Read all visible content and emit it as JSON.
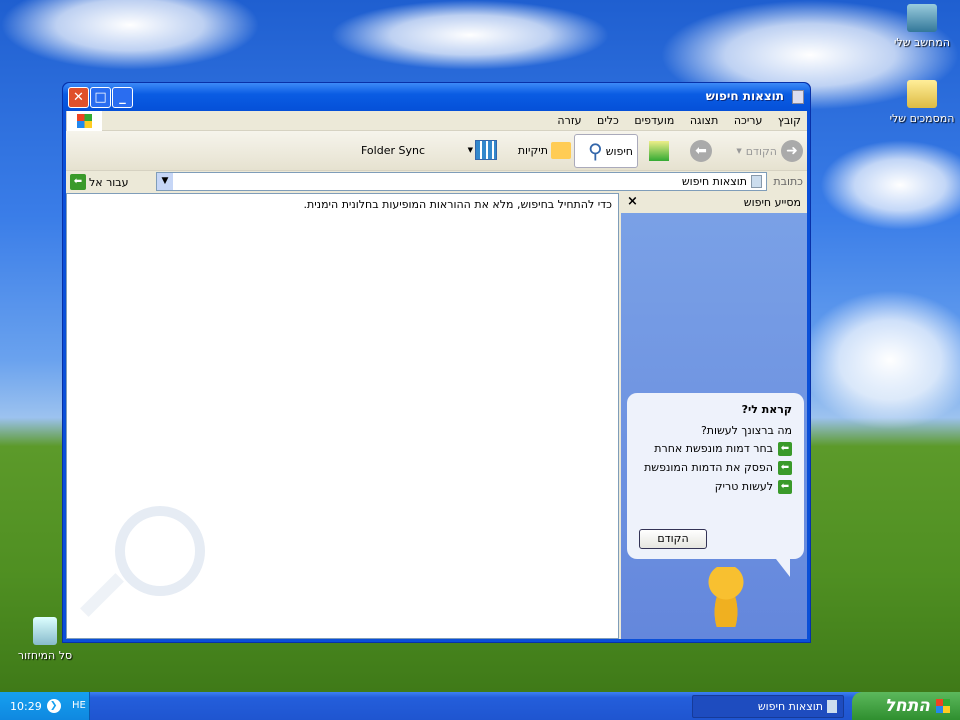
{
  "desktop": {
    "icons": [
      {
        "label": "המחשב שלי"
      },
      {
        "label": "המסמכים שלי"
      },
      {
        "label": "סל המיחזור"
      }
    ]
  },
  "window": {
    "title": "תוצאות חיפוש",
    "menu": [
      "קובץ",
      "עריכה",
      "תצוגה",
      "מועדפים",
      "כלים",
      "עזרה"
    ],
    "toolbar": {
      "back": "הקודם",
      "search": "חיפוש",
      "folders": "תיקיות",
      "folder_sync": "Folder Sync"
    },
    "address": {
      "label": "כתובת",
      "value": "תוצאות חיפוש",
      "go": "עבור אל"
    },
    "results_message": "כדי להתחיל בחיפוש, מלא את ההוראות המופיעות בחלונית הימנית.",
    "companion": {
      "title": "מסייע חיפוש",
      "close": "×",
      "bubble_title": "קראת לי?",
      "question": "מה ברצונך לעשות?",
      "options": [
        "בחר דמות מונפשת אחרת",
        "הפסק את הדמות המונפשת",
        "לעשות טריק"
      ],
      "back": "הקודם"
    }
  },
  "taskbar": {
    "start": "התחל",
    "task": "תוצאות חיפוש",
    "lang": "HE",
    "clock": "10:29"
  }
}
